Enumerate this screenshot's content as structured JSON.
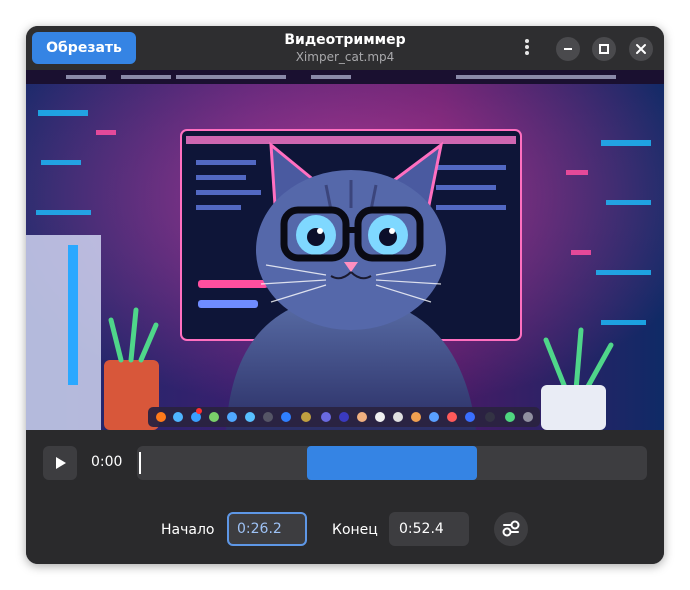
{
  "header": {
    "trim_button": "Обрезать",
    "title": "Видеотриммер",
    "subtitle": "Ximper_cat.mp4",
    "menu_icon": "vertical-dots-icon",
    "window_buttons": [
      "minimize-icon",
      "maximize-icon",
      "close-icon"
    ]
  },
  "video": {
    "description_icon": "video-frame",
    "accent": "#ff3fa8"
  },
  "player": {
    "play_icon": "play-icon",
    "current_time": "0:00",
    "selection_start_fraction": 0.333,
    "selection_end_fraction": 0.667
  },
  "trim": {
    "start_label": "Начало",
    "start_value": "0:26.2",
    "end_label": "Конец",
    "end_value": "0:52.4",
    "extra_icon": "settings-toggle-icon"
  },
  "colors": {
    "accent": "#3584e4",
    "window_bg": "#2a2a2c",
    "button_bg": "#3d3d40"
  }
}
